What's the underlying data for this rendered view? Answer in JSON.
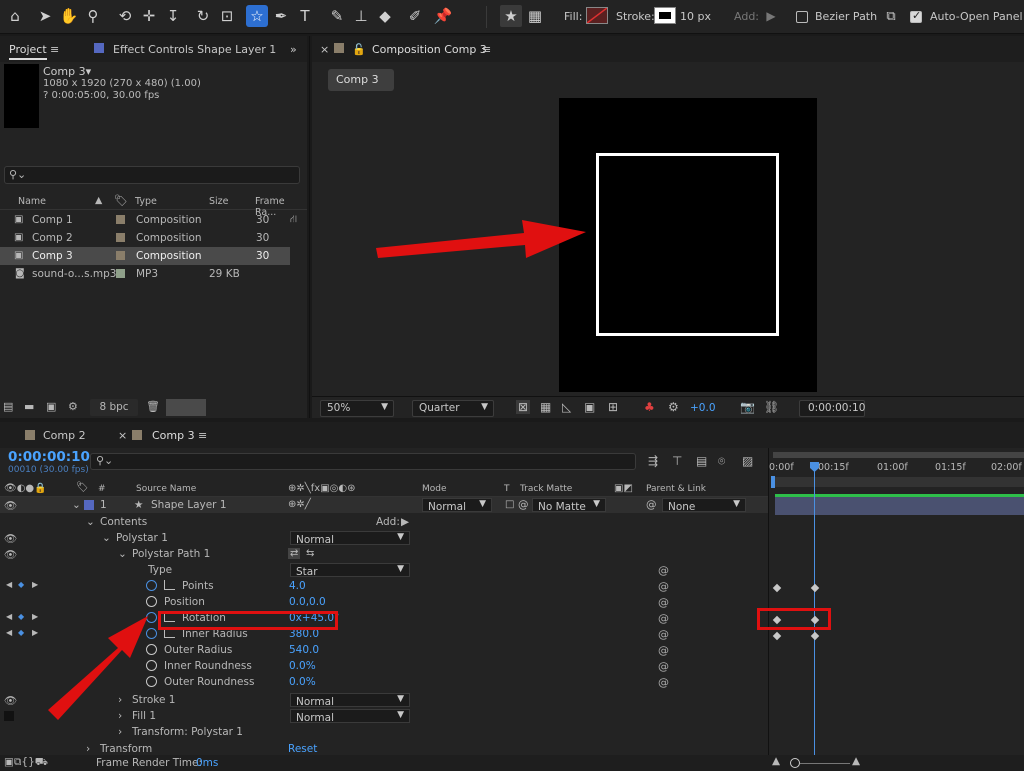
{
  "toolbar": {
    "fill_label": "Fill:",
    "stroke_label": "Stroke:",
    "stroke_width": "10 px",
    "add_label": "Add:",
    "bezier_label": "Bezier Path",
    "auto_open_label": "Auto-Open Panel"
  },
  "project_panel": {
    "tab_label": "Project",
    "effect_tab_label": "Effect Controls Shape Layer 1",
    "comp_name": "Comp 3▾",
    "comp_info_line1": "1080 x 1920  (270 x 480) (1.00)",
    "comp_info_line2": "? 0:00:05:00, 30.00 fps",
    "search_placeholder": "",
    "columns": {
      "name": "Name",
      "type": "Type",
      "size": "Size",
      "frame_rate": "Frame Ra..."
    },
    "items": [
      {
        "name": "Comp 1",
        "type": "Composition",
        "size": "",
        "frame_rate": "30"
      },
      {
        "name": "Comp 2",
        "type": "Composition",
        "size": "",
        "frame_rate": "30"
      },
      {
        "name": "Comp 3",
        "type": "Composition",
        "size": "",
        "frame_rate": "30"
      },
      {
        "name": "sound-o...s.mp3",
        "type": "MP3",
        "size": "29 KB",
        "frame_rate": ""
      }
    ],
    "bpc": "8 bpc"
  },
  "viewer": {
    "tab_label": "Composition Comp 3",
    "comp_tab": "Comp 3",
    "zoom": "50%",
    "resolution": "Quarter",
    "exposure": "+0.0",
    "timecode": "0:00:00:10"
  },
  "timeline": {
    "tab_comp2": "Comp 2",
    "tab_comp3": "Comp 3",
    "current_time": "0:00:00:10",
    "frame_info": "00010 (30.00 fps)",
    "columns": {
      "source_name": "Source Name",
      "mode": "Mode",
      "t": "T",
      "track_matte": "Track Matte",
      "parent_link": "Parent & Link"
    },
    "layer": {
      "number": "1",
      "name": "Shape Layer 1",
      "mode": "Normal",
      "matte": "No Matte",
      "parent": "None"
    },
    "contents_label": "Contents",
    "add_label": "Add:",
    "polystar_label": "Polystar 1",
    "polystar_mode": "Normal",
    "polystar_path_label": "Polystar Path 1",
    "props": {
      "type_label": "Type",
      "type_value": "Star",
      "points_label": "Points",
      "points_value": "4.0",
      "position_label": "Position",
      "position_value": "0.0,0.0",
      "rotation_label": "Rotation",
      "rotation_value": "0x+45.0°",
      "inner_radius_label": "Inner Radius",
      "inner_radius_value": "380.0",
      "outer_radius_label": "Outer Radius",
      "outer_radius_value": "540.0",
      "inner_roundness_label": "Inner Roundness",
      "inner_roundness_value": "0.0%",
      "outer_roundness_label": "Outer Roundness",
      "outer_roundness_value": "0.0%"
    },
    "stroke_label": "Stroke 1",
    "stroke_mode": "Normal",
    "fill_label": "Fill 1",
    "fill_mode": "Normal",
    "transform_polystar_label": "Transform: Polystar 1",
    "transform_label": "Transform",
    "transform_value": "Reset",
    "render_time_label": "Frame Render Time:",
    "render_time_value": "0ms",
    "ruler": [
      "0:00f",
      "00:15f",
      "01:00f",
      "01:15f",
      "02:00f"
    ]
  },
  "colors": {
    "accent": "#4a90e2",
    "annotation_red": "#e01010",
    "layer_bar": "#4a5170"
  }
}
